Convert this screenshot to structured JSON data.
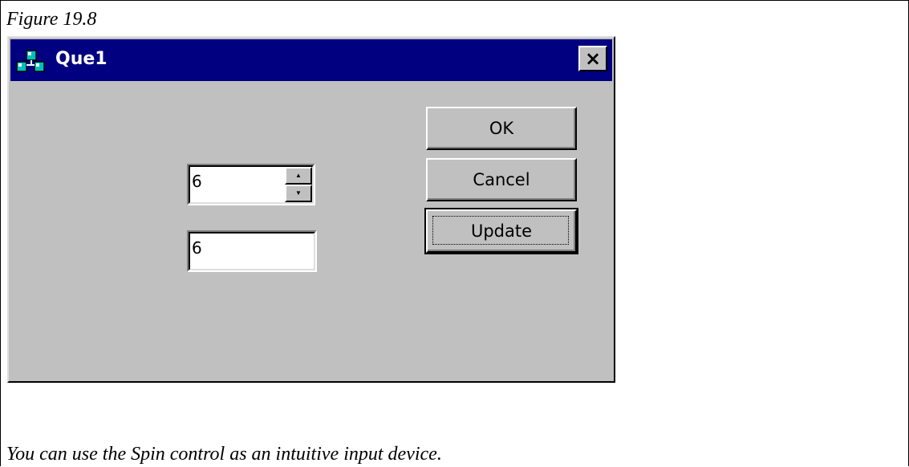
{
  "figure_label": "Figure 19.8",
  "caption": "You can use the Spin control as an intuitive input device.",
  "dialog": {
    "title": "Que1",
    "close_glyph": "×",
    "spin_field": {
      "value": "6",
      "up_glyph": "▲",
      "down_glyph": "▼"
    },
    "mirror_field": {
      "value": "6"
    },
    "buttons": {
      "ok": "OK",
      "cancel": "Cancel",
      "update": "Update"
    }
  },
  "colors": {
    "titlebar": "#000080",
    "face": "#c0c0c0",
    "title_text": "#ffffff"
  },
  "icons": {
    "app": "app-cubes-icon",
    "close": "close-icon",
    "spin_up": "spin-up-arrow-icon",
    "spin_down": "spin-down-arrow-icon"
  }
}
